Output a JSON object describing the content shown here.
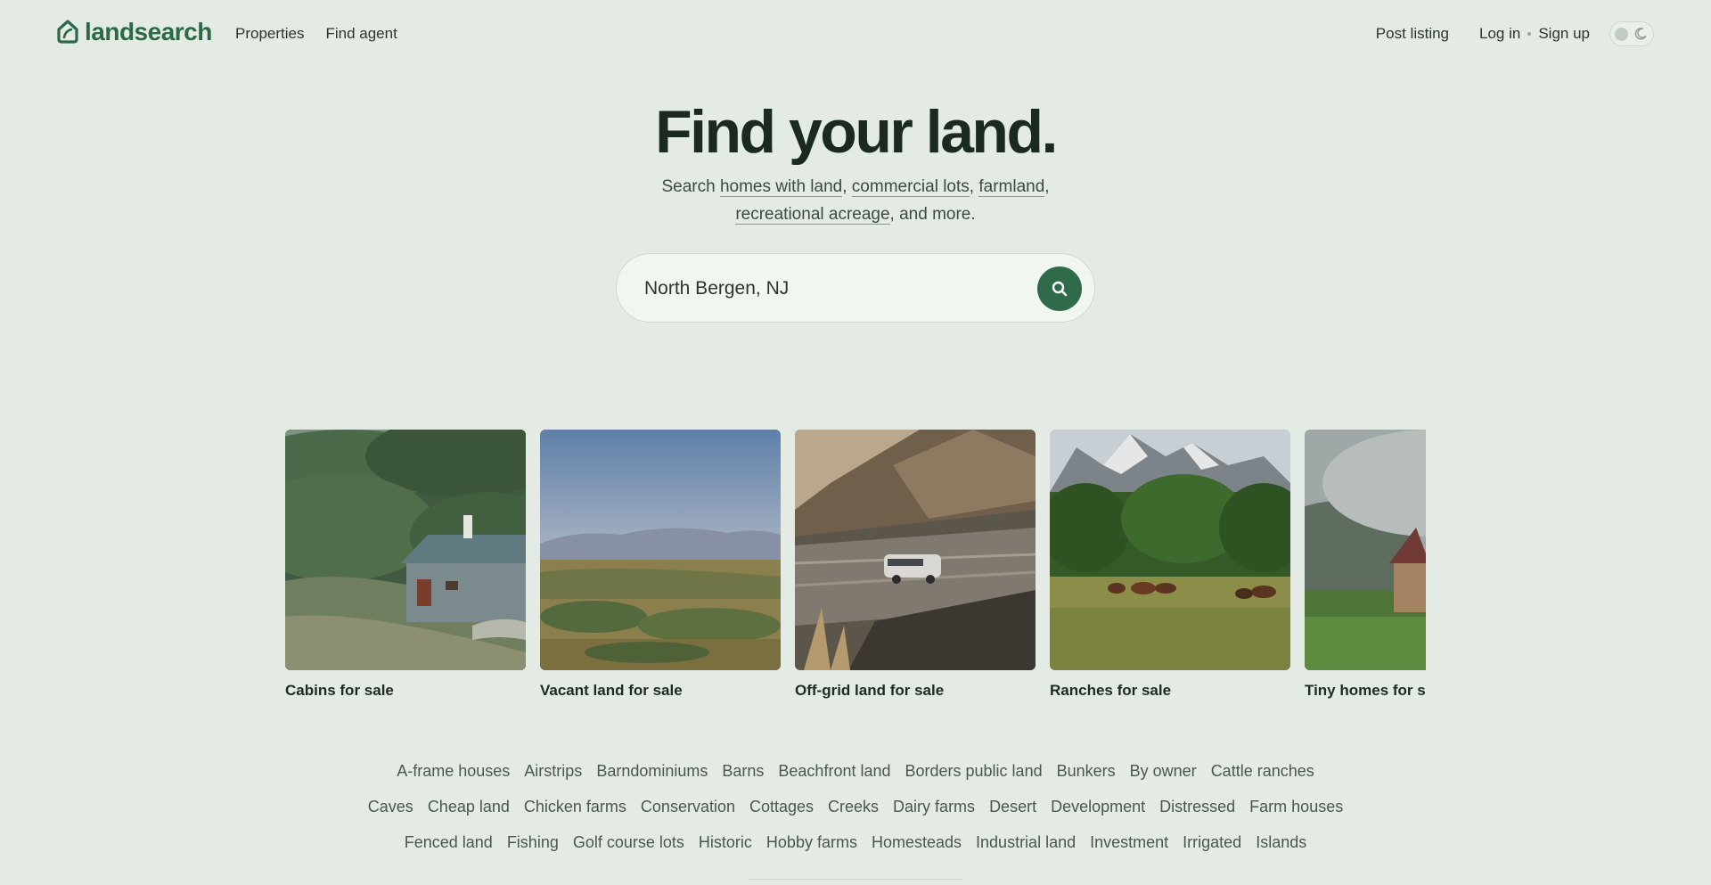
{
  "header": {
    "logo_text": "landsearch",
    "nav_left": [
      {
        "label": "Properties"
      },
      {
        "label": "Find agent"
      }
    ],
    "post_listing": "Post listing",
    "log_in": "Log in",
    "sign_up": "Sign up",
    "theme_toggle_icon": "moon-icon"
  },
  "hero": {
    "title": "Find your land.",
    "sub_prefix": "Search ",
    "links": [
      "homes with land",
      "commercial lots",
      "farmland",
      "recreational acreage"
    ],
    "sep1": ", ",
    "sep2": ", ",
    "sep3": ",",
    "sub_suffix": ", and more."
  },
  "search": {
    "value": "North Bergen, NJ",
    "placeholder": "",
    "button_icon": "search-icon"
  },
  "categories": [
    {
      "label": "Cabins for sale"
    },
    {
      "label": "Vacant land for sale"
    },
    {
      "label": "Off-grid land for sale"
    },
    {
      "label": "Ranches for sale"
    },
    {
      "label": "Tiny homes for sale"
    }
  ],
  "tags": {
    "row1": [
      "A-frame houses",
      "Airstrips",
      "Barndominiums",
      "Barns",
      "Beachfront land",
      "Borders public land",
      "Bunkers",
      "By owner",
      "Cattle ranches"
    ],
    "row2": [
      "Caves",
      "Cheap land",
      "Chicken farms",
      "Conservation",
      "Cottages",
      "Creeks",
      "Dairy farms",
      "Desert",
      "Development",
      "Distressed",
      "Farm houses"
    ],
    "row3": [
      "Fenced land",
      "Fishing",
      "Golf course lots",
      "Historic",
      "Hobby farms",
      "Homesteads",
      "Industrial land",
      "Investment",
      "Irrigated",
      "Islands"
    ]
  },
  "colors": {
    "background": "#e4ebe4",
    "brand_green": "#2a6a46",
    "search_button": "#2f6b4a",
    "text_dark": "#1d2b21"
  }
}
